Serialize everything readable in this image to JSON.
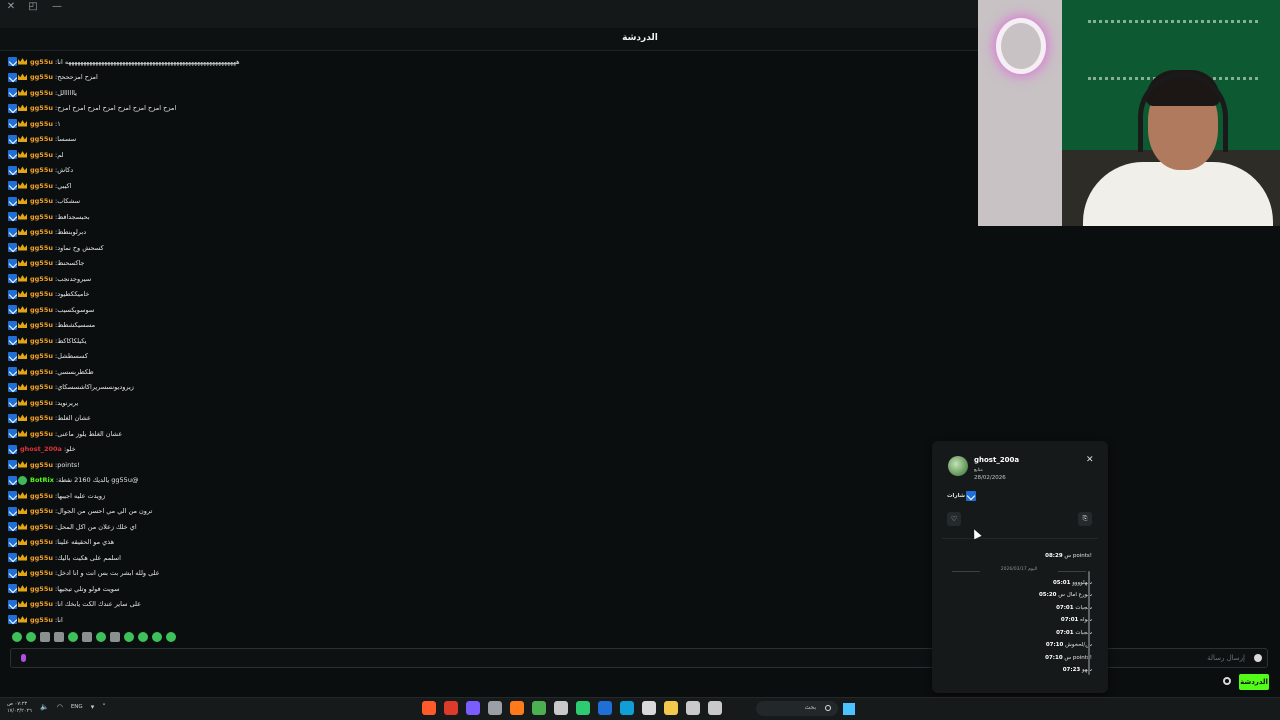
{
  "window": {
    "close": "✕",
    "restore": "◰",
    "minimize": "—"
  },
  "chat": {
    "title": "الدردشة",
    "messages": [
      {
        "user": "gg55u",
        "badges": [
          "blue",
          "gold"
        ],
        "color": "orange",
        "text": "هههههههههههههههههههههههههههههههههههههههههههههههههههههههههه انا"
      },
      {
        "user": "gg55u",
        "badges": [
          "blue",
          "gold"
        ],
        "color": "orange",
        "text": "امزح امزحححح"
      },
      {
        "user": "gg55u",
        "badges": [
          "blue",
          "gold"
        ],
        "color": "orange",
        "text": "ياااااالل"
      },
      {
        "user": "gg55u",
        "badges": [
          "blue",
          "gold"
        ],
        "color": "orange",
        "text": "امزح امزح امزح امزح امزح امزح امزح امزح"
      },
      {
        "user": "gg55u",
        "badges": [
          "blue",
          "gold"
        ],
        "color": "orange",
        "text": "١"
      },
      {
        "user": "gg55u",
        "badges": [
          "blue",
          "gold"
        ],
        "color": "orange",
        "text": "سسسا"
      },
      {
        "user": "gg55u",
        "badges": [
          "blue",
          "gold"
        ],
        "color": "orange",
        "text": "لم"
      },
      {
        "user": "gg55u",
        "badges": [
          "blue",
          "gold"
        ],
        "color": "orange",
        "text": "دكاش"
      },
      {
        "user": "gg55u",
        "badges": [
          "blue",
          "gold"
        ],
        "color": "orange",
        "text": "اكيبي"
      },
      {
        "user": "gg55u",
        "badges": [
          "blue",
          "gold"
        ],
        "color": "orange",
        "text": "سشكاب"
      },
      {
        "user": "gg55u",
        "badges": [
          "blue",
          "gold"
        ],
        "color": "orange",
        "text": "بحبسجدافظ"
      },
      {
        "user": "gg55u",
        "badges": [
          "blue",
          "gold"
        ],
        "color": "orange",
        "text": "دبرلوبنطظ"
      },
      {
        "user": "gg55u",
        "badges": [
          "blue",
          "gold"
        ],
        "color": "orange",
        "text": "كسحش وح نماود"
      },
      {
        "user": "gg55u",
        "badges": [
          "blue",
          "gold"
        ],
        "color": "orange",
        "text": "جاكسحنظ"
      },
      {
        "user": "gg55u",
        "badges": [
          "blue",
          "gold"
        ],
        "color": "orange",
        "text": "سيروجدنجب"
      },
      {
        "user": "gg55u",
        "badges": [
          "blue",
          "gold"
        ],
        "color": "orange",
        "text": "خاميككطيود"
      },
      {
        "user": "gg55u",
        "badges": [
          "blue",
          "gold"
        ],
        "color": "orange",
        "text": "سوسويكسيب"
      },
      {
        "user": "gg55u",
        "badges": [
          "blue",
          "gold"
        ],
        "color": "orange",
        "text": "مسسيكشطظ"
      },
      {
        "user": "gg55u",
        "badges": [
          "blue",
          "gold"
        ],
        "color": "orange",
        "text": "يكيلكاكاكظ"
      },
      {
        "user": "gg55u",
        "badges": [
          "blue",
          "gold"
        ],
        "color": "orange",
        "text": "كسسطشل"
      },
      {
        "user": "gg55u",
        "badges": [
          "blue",
          "gold"
        ],
        "color": "orange",
        "text": "ظكظربسسي"
      },
      {
        "user": "gg55u",
        "badges": [
          "blue",
          "gold"
        ],
        "color": "orange",
        "text": "زيروديونسسريراكاشسسكاي"
      },
      {
        "user": "gg55u",
        "badges": [
          "blue",
          "gold"
        ],
        "color": "orange",
        "text": "يريرنويد"
      },
      {
        "user": "gg55u",
        "badges": [
          "blue",
          "gold"
        ],
        "color": "orange",
        "text": "عشان الغلط"
      },
      {
        "user": "gg55u",
        "badges": [
          "blue",
          "gold"
        ],
        "color": "orange",
        "text": "عشان الغلط يلوز ماعنى"
      },
      {
        "user": "ghost_200a",
        "badges": [
          "blue"
        ],
        "color": "red",
        "text": "خلو"
      },
      {
        "user": "gg55u",
        "badges": [
          "blue",
          "gold"
        ],
        "color": "orange",
        "text": "!points"
      },
      {
        "user": "BotRix",
        "badges": [
          "blue",
          "green"
        ],
        "color": "green",
        "text": "@gg55u يالديك 2160 نقطة"
      },
      {
        "user": "gg55u",
        "badges": [
          "blue",
          "gold"
        ],
        "color": "orange",
        "text": "زويدت عليه اجيبها"
      },
      {
        "user": "gg55u",
        "badges": [
          "blue",
          "gold"
        ],
        "color": "orange",
        "text": "ترون من الي مي احسن من الجوال"
      },
      {
        "user": "gg55u",
        "badges": [
          "blue",
          "gold"
        ],
        "color": "orange",
        "text": "اي خلك زعلان من اكل المحل"
      },
      {
        "user": "gg55u",
        "badges": [
          "blue",
          "gold"
        ],
        "color": "orange",
        "text": "هذي مو الحقيقه علينا"
      },
      {
        "user": "gg55u",
        "badges": [
          "blue",
          "gold"
        ],
        "color": "orange",
        "text": "اسلمم على هكيت باليك"
      },
      {
        "user": "gg55u",
        "badges": [
          "blue",
          "gold"
        ],
        "color": "orange",
        "text": "على ولله ابشر بت بس انت و انا ادخل"
      },
      {
        "user": "gg55u",
        "badges": [
          "blue",
          "gold"
        ],
        "color": "orange",
        "text": "سويت فولو وتلي تيجيها"
      },
      {
        "user": "gg55u",
        "badges": [
          "blue",
          "gold"
        ],
        "color": "orange",
        "text": "على ساير عندك الكت يابخك انا"
      },
      {
        "user": "gg55u",
        "badges": [
          "blue",
          "gold"
        ],
        "color": "orange",
        "text": "انا"
      }
    ],
    "emotes": [
      "green",
      "green",
      "alt",
      "alt",
      "green",
      "alt",
      "green",
      "alt",
      "green",
      "green",
      "green",
      "green"
    ],
    "input_placeholder": "إرسال رسالة",
    "send_label": "الدردشة",
    "colors": {
      "accent": "#53fc18",
      "username": "#f3a32a",
      "mod_red": "#e0333a"
    }
  },
  "user_card": {
    "username": "ghost_200a",
    "follow_label": "متابع",
    "follow_date": "28/02/2026",
    "badges_label": "شارات",
    "close": "✕",
    "heart": "♡",
    "clip": "⎘",
    "day_label": "اليوم 2026/03/17",
    "first_entry": {
      "time": "08:29",
      "text": "!points س"
    },
    "log": [
      {
        "time": "05:01",
        "text": "سهلوووو"
      },
      {
        "time": "05:20",
        "text": "سورع امال س"
      },
      {
        "time": "07:01",
        "text": "سجبات"
      },
      {
        "time": "07:01",
        "text": "سواه"
      },
      {
        "time": "07:01",
        "text": "سجبات"
      },
      {
        "time": "07:10",
        "text": "س/لحخوش"
      },
      {
        "time": "07:10",
        "text": "!points س"
      },
      {
        "time": "07:23",
        "text": "سهو"
      }
    ]
  },
  "taskbar": {
    "clock_time": "٠٧:٢٣ ص",
    "clock_date": "١٧/٠٣/٢٠٢٦",
    "lang": "ENG",
    "search_label": "بحث",
    "apps": [
      "#ff5a2a",
      "#db3b2a",
      "#7a5cff",
      "#9aa0a6",
      "#ff7a1a",
      "#4caf50",
      "#c9c9c9",
      "#2ecc71",
      "#1f6fd6",
      "#0f9ed5",
      "#d9d9d9",
      "#f2c94c",
      "#c9c9c9",
      "#c9c9c9"
    ]
  }
}
